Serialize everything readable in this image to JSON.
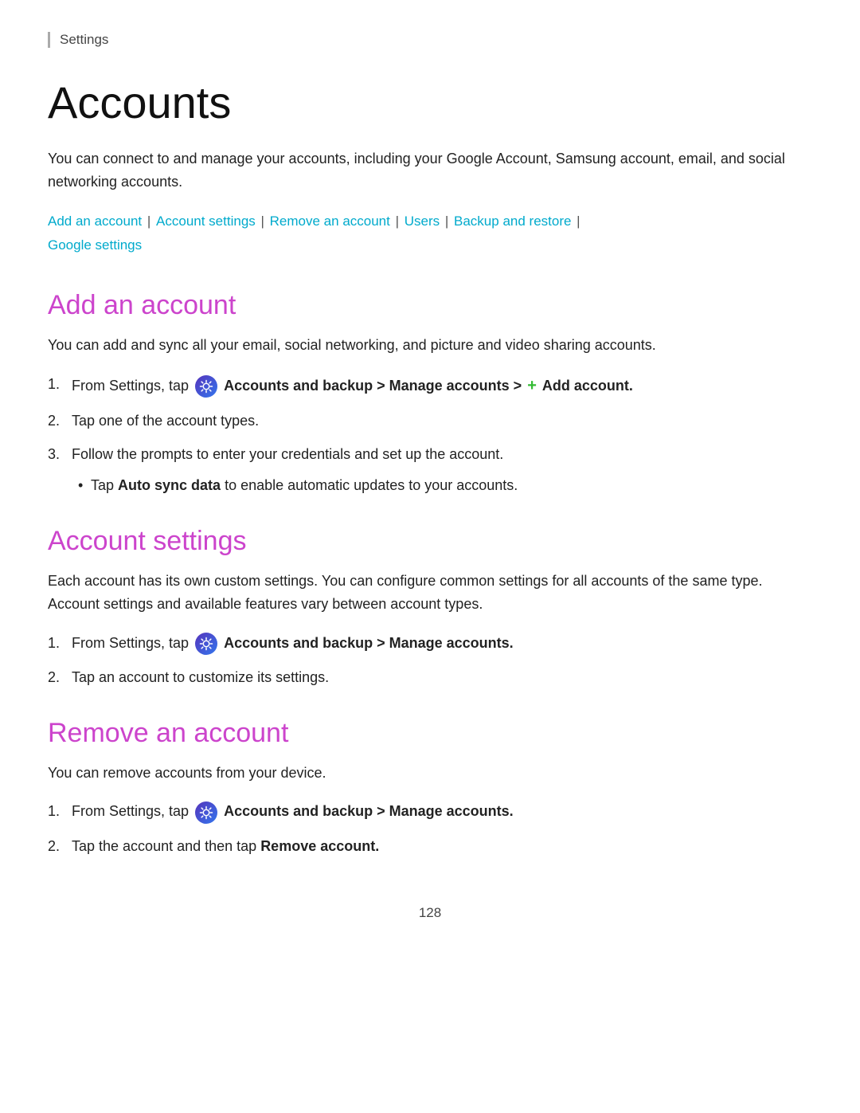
{
  "breadcrumb": "Settings",
  "page_title": "Accounts",
  "intro_text": "You can connect to and manage your accounts, including your Google Account, Samsung account, email, and social networking accounts.",
  "nav_links": [
    {
      "label": "Add an account",
      "href": "#add"
    },
    {
      "label": "Account settings",
      "href": "#settings"
    },
    {
      "label": "Remove an account",
      "href": "#remove"
    },
    {
      "label": "Users",
      "href": "#users"
    },
    {
      "label": "Backup and restore",
      "href": "#backup"
    },
    {
      "label": "Google settings",
      "href": "#google"
    }
  ],
  "sections": [
    {
      "id": "add",
      "title": "Add an account",
      "description": "You can add and sync all your email, social networking, and picture and video sharing accounts.",
      "steps": [
        {
          "num": "1.",
          "html_key": "add_step1",
          "text_parts": [
            {
              "type": "text",
              "value": "From Settings, tap "
            },
            {
              "type": "icon"
            },
            {
              "type": "bold",
              "value": "Accounts and backup > Manage accounts > "
            },
            {
              "type": "plus"
            },
            {
              "type": "bold",
              "value": " Add account."
            }
          ],
          "bullets": []
        },
        {
          "num": "2.",
          "html_key": "add_step2",
          "text": "Tap one of the account types.",
          "bullets": []
        },
        {
          "num": "3.",
          "html_key": "add_step3",
          "text": "Follow the prompts to enter your credentials and set up the account.",
          "bullets": [
            "Tap Auto sync data to enable automatic updates to your accounts."
          ]
        }
      ]
    },
    {
      "id": "settings",
      "title": "Account settings",
      "description": "Each account has its own custom settings. You can configure common settings for all accounts of the same type. Account settings and available features vary between account types.",
      "steps": [
        {
          "num": "1.",
          "html_key": "settings_step1",
          "text_parts": [
            {
              "type": "text",
              "value": "From Settings, tap "
            },
            {
              "type": "icon"
            },
            {
              "type": "bold",
              "value": "Accounts and backup > Manage accounts."
            }
          ],
          "bullets": []
        },
        {
          "num": "2.",
          "html_key": "settings_step2",
          "text": "Tap an account to customize its settings.",
          "bullets": []
        }
      ]
    },
    {
      "id": "remove",
      "title": "Remove an account",
      "description": "You can remove accounts from your device.",
      "steps": [
        {
          "num": "1.",
          "html_key": "remove_step1",
          "text_parts": [
            {
              "type": "text",
              "value": "From Settings, tap "
            },
            {
              "type": "icon"
            },
            {
              "type": "bold",
              "value": "Accounts and backup > Manage accounts."
            }
          ],
          "bullets": []
        },
        {
          "num": "2.",
          "html_key": "remove_step2",
          "text_before": "Tap the account and then tap ",
          "bold_text": "Remove account.",
          "bullets": []
        }
      ]
    }
  ],
  "page_number": "128"
}
